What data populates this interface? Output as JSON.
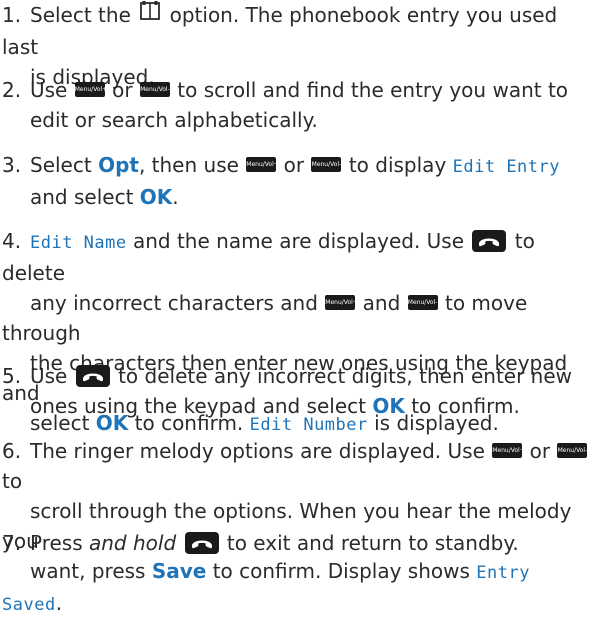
{
  "steps": [
    {
      "num": "1.",
      "parts": [
        {
          "t": "Select the "
        },
        {
          "icon": "phonebook-icon"
        },
        {
          "t": " option. The phonebook entry you used last"
        },
        {
          "br": true
        },
        {
          "t": "is displayed."
        }
      ]
    },
    {
      "num": "2.",
      "parts": [
        {
          "t": "Use "
        },
        {
          "key": "Menu/Vol+"
        },
        {
          "t": " or "
        },
        {
          "key": "Menu/Vol-"
        },
        {
          "t": " to scroll and find the entry you want to"
        },
        {
          "br": true
        },
        {
          "t": "edit or search alphabetically."
        }
      ]
    },
    {
      "num": "3.",
      "parts": [
        {
          "t": "Select "
        },
        {
          "b": "Opt"
        },
        {
          "t": ", then use "
        },
        {
          "key": "Menu/Vol+"
        },
        {
          "t": " or "
        },
        {
          "key": "Menu/Vol-"
        },
        {
          "t": " to display "
        },
        {
          "lcd": "Edit Entry"
        },
        {
          "br": true
        },
        {
          "t": "and select "
        },
        {
          "b": "OK"
        },
        {
          "t": "."
        }
      ]
    },
    {
      "num": "4.",
      "parts": [
        {
          "lcd": "Edit Name"
        },
        {
          "t": " and the name are displayed. Use "
        },
        {
          "endkey": "end-call-key-icon"
        },
        {
          "t": " to delete"
        },
        {
          "br": true
        },
        {
          "t": "any incorrect characters and "
        },
        {
          "key": "Menu/Vol+"
        },
        {
          "t": " and "
        },
        {
          "key": "Menu/Vol-"
        },
        {
          "t": " to move through"
        },
        {
          "br": true
        },
        {
          "t": "the characters then enter new ones using the keypad and"
        },
        {
          "br": true
        },
        {
          "t": "select "
        },
        {
          "b": "OK"
        },
        {
          "t": " to confirm. "
        },
        {
          "lcd": "Edit Number"
        },
        {
          "t": " is displayed."
        }
      ]
    },
    {
      "num": "5.",
      "parts": [
        {
          "t": "Use "
        },
        {
          "endkey": "end-call-key-icon"
        },
        {
          "t": " to delete any incorrect digits, then enter new"
        },
        {
          "br": true
        },
        {
          "t": "ones using the keypad and select "
        },
        {
          "b": "OK"
        },
        {
          "t": " to confirm."
        }
      ]
    },
    {
      "num": "6.",
      "parts": [
        {
          "t": "The ringer melody options are displayed. Use "
        },
        {
          "key": "Menu/Vol+"
        },
        {
          "t": " or "
        },
        {
          "key": "Menu/Vol-"
        },
        {
          "t": " to"
        },
        {
          "br": true
        },
        {
          "t": "scroll through the options. When you hear the melody you"
        },
        {
          "br": true
        },
        {
          "t": "want, press "
        },
        {
          "b": "Save"
        },
        {
          "t": " to confirm. Display shows "
        },
        {
          "lcd": "Entry Saved"
        },
        {
          "t": "."
        }
      ]
    },
    {
      "num": "7.",
      "parts": [
        {
          "t": "Press "
        },
        {
          "i": "and hold"
        },
        {
          "t": " "
        },
        {
          "endkey": "end-call-key-icon"
        },
        {
          "t": " to exit and return to standby."
        }
      ]
    }
  ]
}
